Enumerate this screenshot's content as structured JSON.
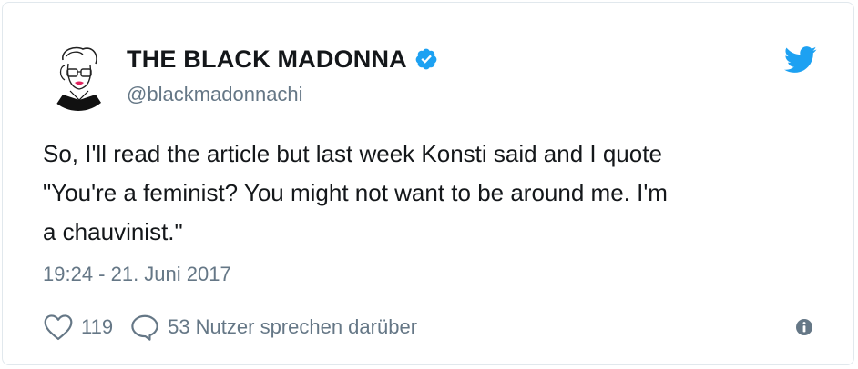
{
  "user": {
    "display_name": "THE BLACK MADONNA",
    "handle": "@blackmadonnachi",
    "verified": true,
    "avatar_icon": "woman-sketch-avatar"
  },
  "tweet": {
    "text_line_1": "So, I'll read the article but last week Konsti said and I quote",
    "text_line_2": "\"You're a feminist? You might not want to be around me. I'm",
    "text_line_3": "a chauvinist.\"",
    "timestamp": "19:24 - 21. Juni 2017"
  },
  "actions": {
    "likes_count": "119",
    "replies_label": "53 Nutzer sprechen darüber"
  },
  "icons": {
    "brand": "twitter-bird-icon",
    "verified": "verified-badge-icon",
    "like": "heart-icon",
    "reply": "speech-bubble-icon",
    "info": "info-icon"
  },
  "colors": {
    "brand_blue": "#1da1f2",
    "text_primary": "#14171a",
    "text_secondary": "#657786",
    "border": "#e1e8ed"
  }
}
